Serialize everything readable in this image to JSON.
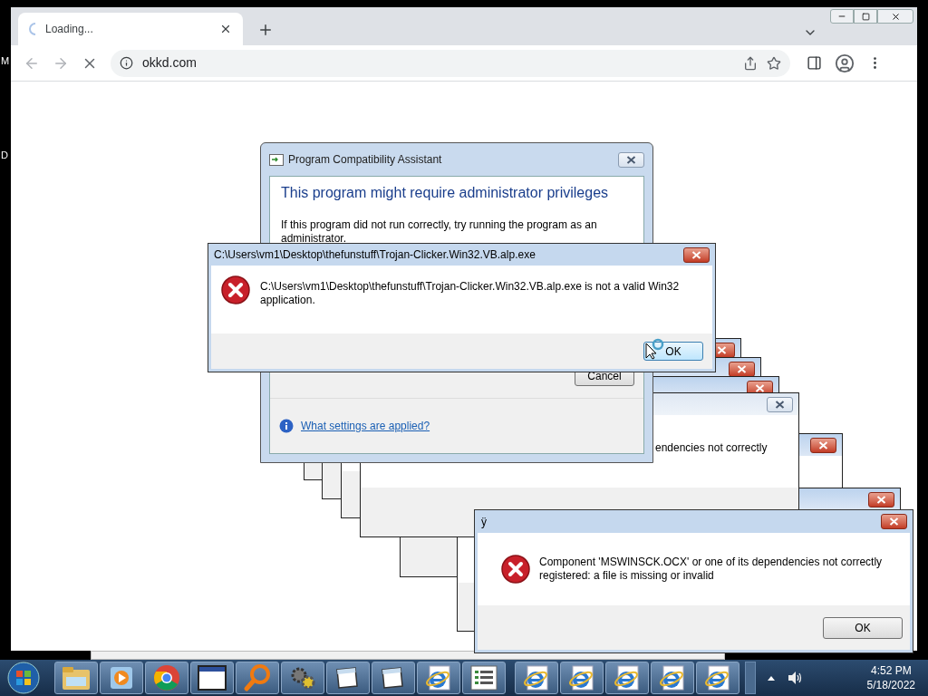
{
  "desktop_labels": [
    "M",
    "D"
  ],
  "browser": {
    "tab": {
      "title": "Loading...",
      "loading": true
    },
    "address": "okkd.com"
  },
  "compat_dialog": {
    "title": "Program Compatibility Assistant",
    "heading": "This program might require administrator privileges",
    "message": "If this program did not run correctly, try running the program as an administrator.",
    "cancel": "Cancel",
    "link": "What settings are applied?"
  },
  "stacked_dialogs": [
    {
      "kind": "active"
    },
    {
      "kind": "active"
    },
    {
      "kind": "active"
    },
    {
      "kind": "inactive",
      "fragment": "endencies not correctly"
    },
    {
      "kind": "active"
    },
    {
      "kind": "active"
    }
  ],
  "error_dialog": {
    "title": "C:\\Users\\vm1\\Desktop\\thefunstuff\\Trojan-Clicker.Win32.VB.alp.exe",
    "message": "C:\\Users\\vm1\\Desktop\\thefunstuff\\Trojan-Clicker.Win32.VB.alp.exe is not a valid Win32 application.",
    "ok": "OK"
  },
  "component_dialog": {
    "title": "ÿ",
    "message": "Component 'MSWINSCK.OCX' or one of its dependencies not correctly registered: a file is missing or invalid",
    "ok": "OK"
  },
  "taskbar": {
    "items": [
      {
        "kind": "folder"
      },
      {
        "kind": "media"
      },
      {
        "kind": "chrome"
      },
      {
        "kind": "window"
      },
      {
        "kind": "search"
      },
      {
        "kind": "gears"
      },
      {
        "kind": "window-plain"
      },
      {
        "kind": "window-plain"
      },
      {
        "kind": "ie"
      },
      {
        "kind": "list"
      },
      {
        "kind": "ie"
      },
      {
        "kind": "ie"
      },
      {
        "kind": "ie"
      },
      {
        "kind": "ie"
      },
      {
        "kind": "ie"
      }
    ],
    "time": "4:52 PM",
    "date": "5/18/2022"
  }
}
